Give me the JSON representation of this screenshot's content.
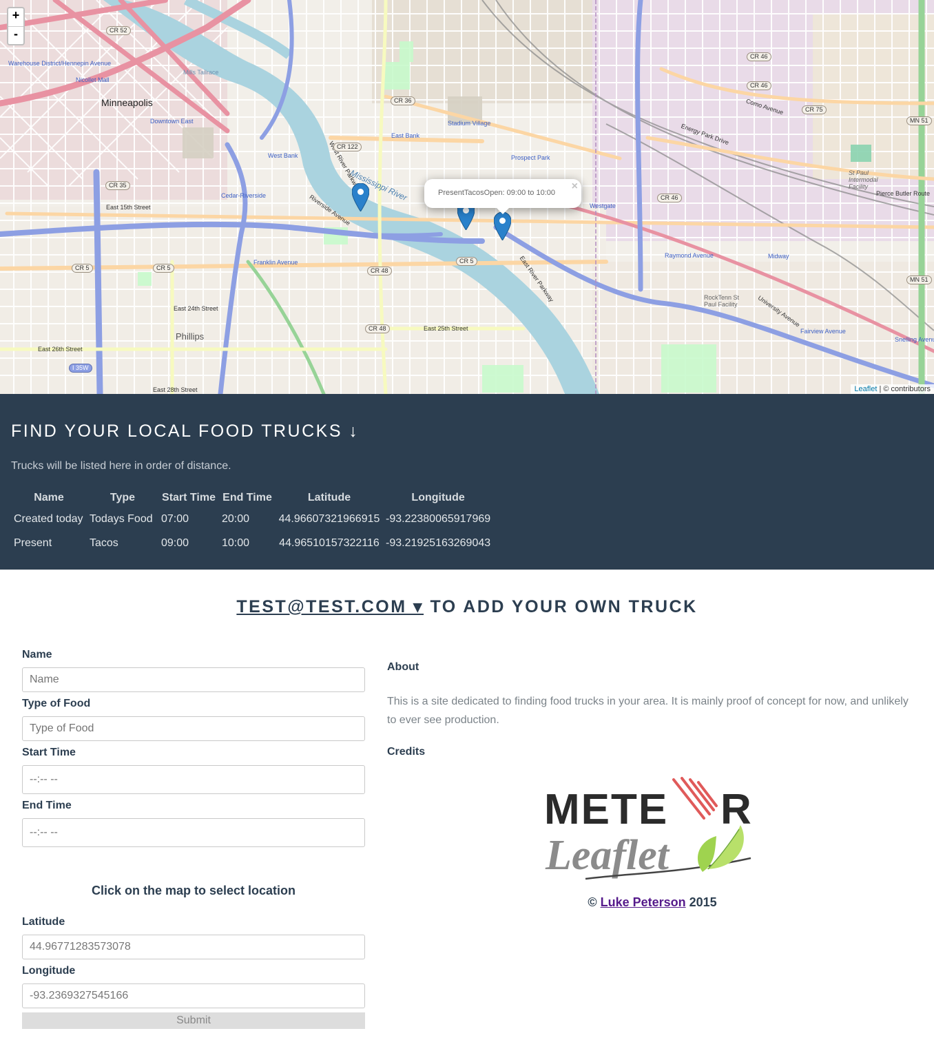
{
  "map": {
    "zoom_in": "+",
    "zoom_out": "-",
    "popup_text": "PresentTacosOpen: 09:00 to 10:00",
    "popup_close": "×",
    "attribution_link": "Leaflet",
    "attribution_rest": " | © contributors",
    "labels": {
      "minneapolis": "Minneapolis",
      "phillips": "Phillips",
      "mississippi": "Mississippi River",
      "nicollet_mall": "Nicollet Mall",
      "downtown_east": "Downtown East",
      "warehouse": "Warehouse District/Hennepin Avenue",
      "west_bank": "West Bank",
      "east_bank": "East Bank",
      "stadium_village": "Stadium Village",
      "prospect_park": "Prospect Park",
      "cedar_riverside": "Cedar-Riverside",
      "franklin_ave": "Franklin Avenue",
      "westgate": "Westgate",
      "raymond_ave": "Raymond Avenue",
      "midway": "Midway",
      "fairview_ave": "Fairview Avenue",
      "snelling_ave": "Snelling Avenue",
      "mills_tailrace": "Mills Tailrace",
      "east_15th": "East 15th Street",
      "east_24th": "East 24th Street",
      "east_25th": "East 25th Street",
      "east_26th": "East 26th Street",
      "east_28th": "East 28th Street",
      "como_ave": "Como Avenue",
      "energy_park": "Energy Park Drive",
      "university_ave": "University Avenue",
      "east_river_pkwy": "East River Parkway",
      "riverside_ave": "Riverside Avenue",
      "west_river_pkwy": "West River Parkway",
      "st_paul_intermodal": "St Paul Intermodal Facility",
      "rocktenn": "RockTenn St Paul Facility",
      "pierce_butler": "Pierce Butler Route"
    },
    "shields": {
      "cr52": "CR 52",
      "cr36": "CR 36",
      "cr122": "CR 122",
      "cr35": "CR 35",
      "cr5a": "CR 5",
      "cr5b": "CR 5",
      "cr5c": "CR 5",
      "cr48a": "CR 48",
      "cr48b": "CR 48",
      "cr46a": "CR 46",
      "cr46b": "CR 46",
      "cr46c": "CR 46",
      "cr75": "CR 75",
      "mn51a": "MN 51",
      "mn51b": "MN 51",
      "i35w": "I 35W"
    }
  },
  "trucks": {
    "title": "FIND YOUR LOCAL FOOD TRUCKS ↓",
    "subtitle": "Trucks will be listed here in order of distance.",
    "columns": [
      "Name",
      "Type",
      "Start Time",
      "End Time",
      "Latitude",
      "Longitude"
    ],
    "rows": [
      [
        "Created today",
        "Todays Food",
        "07:00",
        "20:00",
        "44.96607321966915",
        "-93.22380065917969"
      ],
      [
        "Present",
        "Tacos",
        "09:00",
        "10:00",
        "44.96510157322116",
        "-93.21925163269043"
      ]
    ]
  },
  "add": {
    "user_link": "TEST@TEST.COM ▾",
    "rest": " TO ADD YOUR OWN TRUCK"
  },
  "form": {
    "name_label": "Name",
    "name_placeholder": "Name",
    "food_label": "Type of Food",
    "food_placeholder": "Type of Food",
    "start_label": "Start Time",
    "start_placeholder": "--:-- --",
    "end_label": "End Time",
    "end_placeholder": "--:-- --",
    "hint": "Click on the map to select location",
    "lat_label": "Latitude",
    "lat_value": "44.96771283573078",
    "lng_label": "Longitude",
    "lng_value": "-93.2369327545166",
    "submit": "Submit"
  },
  "about": {
    "about_heading": "About",
    "about_text": "This is a site dedicated to finding food trucks in your area. It is mainly proof of concept for now, and unlikely to ever see production.",
    "credits_heading": "Credits",
    "logo_top": "METE",
    "logo_r": "R",
    "logo_bottom": "Leaflet",
    "copyright_prefix": "© ",
    "author": "Luke Peterson",
    "year": " 2015"
  },
  "colors": {
    "navy": "#2c3e50",
    "marker": "#2a81cb",
    "link": "#551a8b"
  }
}
